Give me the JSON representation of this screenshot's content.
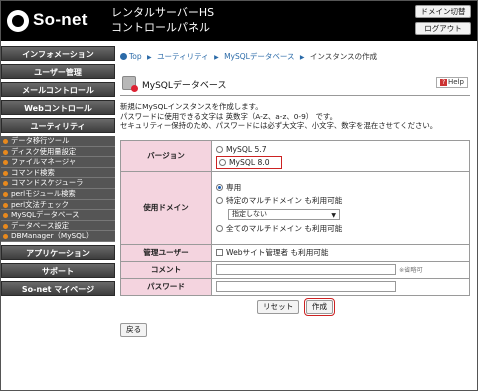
{
  "brand": {
    "logo_text": "So-net"
  },
  "header": {
    "title_line1": "レンタルサーバーHS",
    "title_line2": "コントロールパネル",
    "domain_switch_label": "ドメイン切替",
    "logout_label": "ログアウト"
  },
  "sidebar": {
    "info": "インフォメーション",
    "users": "ユーザー管理",
    "mail": "メールコントロール",
    "web": "Webコントロール",
    "utility": "ユーティリティ",
    "utility_items": [
      "データ移行ツール",
      "ディスク使用量設定",
      "ファイルマネージャ",
      "コマンド検索",
      "コマンドスケジューラ",
      "perlモジュール検索",
      "perl文法チェック",
      "MySQLデータベース",
      "データベース設定",
      "DBManager（MySQL）"
    ],
    "application": "アプリケーション",
    "support": "サポート",
    "sonet_my_page": "So-net マイページ"
  },
  "breadcrumb": {
    "top": "Top",
    "utility": "ユーティリティ",
    "mysql_db": "MySQLデータベース",
    "current": "インスタンスの作成"
  },
  "page": {
    "title": "MySQLデータベース",
    "help_label": "Help",
    "help_glyph": "?",
    "desc_line1": "新規にMySQLインスタンスを作成します。",
    "desc_line2": "パスワードに使用できる文字は 英数字（A-Z、a-z、0-9） です。",
    "desc_line3": "セキュリティー保持のため、パスワードには必ず大文字、小文字、数字を混在させてください。"
  },
  "form": {
    "version_label": "バージョン",
    "version_option_57": "MySQL 5.7",
    "version_option_80": "MySQL 8.0",
    "domain_label": "使用ドメイン",
    "domain_option_dedicated": "専用",
    "domain_option_specific": "特定のマルチドメイン も利用可能",
    "domain_select_value": "指定しない",
    "domain_option_all": "全てのマルチドメイン も利用可能",
    "admin_label": "管理ユーザー",
    "admin_checkbox_label": "Webサイト管理者 も利用可能",
    "comment_label": "コメント",
    "comment_value": "",
    "comment_note": "※省略可",
    "password_label": "パスワード",
    "password_value": ""
  },
  "buttons": {
    "reset": "リセット",
    "create": "作成",
    "back": "戻る"
  },
  "colors": {
    "label_bg": "#f4d4df",
    "highlight": "#cc2222",
    "sidebar_bullet": "#e8891d"
  }
}
